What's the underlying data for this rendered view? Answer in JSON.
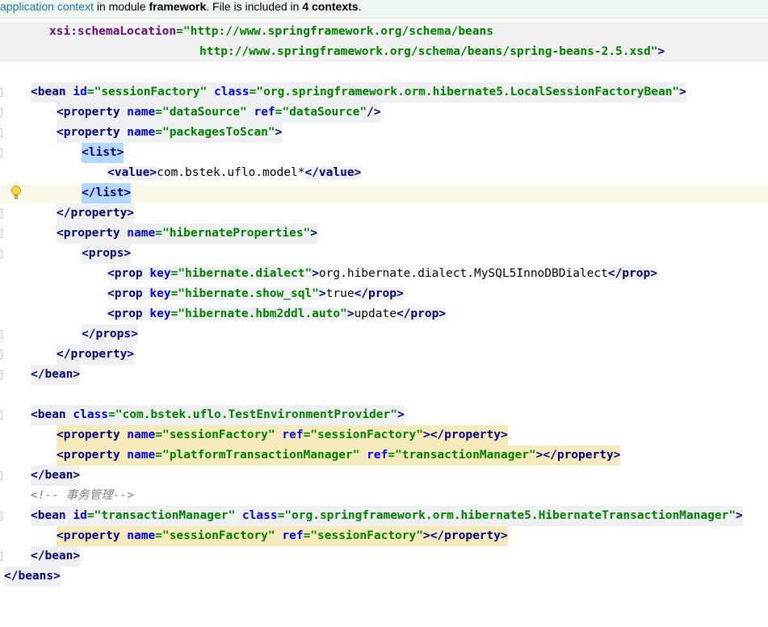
{
  "banner": {
    "link": "application context",
    "t1": " in module ",
    "module": "framework",
    "t2": ". File is included in ",
    "count": "4 contexts",
    "t3": "."
  },
  "code": {
    "l1_a": "xsi:schemaLocation",
    "l1_b": "=\"http://www.springframework.org/schema/beans",
    "l2_a": "http://www.springframework.org/schema/beans/spring-beans-2.5.xsd\"",
    "l2_b": ">",
    "l4_open": "<",
    "l4_tag": "bean",
    "l4_a1": " id",
    "l4_v1": "=\"sessionFactory\"",
    "l4_a2": " class",
    "l4_v2": "=\"org.springframework.orm.hibernate5.LocalSessionFactoryBean\"",
    "l4_close": ">",
    "l5_tag": "<property",
    "l5_a1": " name",
    "l5_v1": "=\"dataSource\"",
    "l5_a2": " ref",
    "l5_v2": "=\"dataSource\"",
    "l5_close": "/>",
    "l6_tag": "<property",
    "l6_a1": " name",
    "l6_v1": "=\"packagesToScan\"",
    "l6_close": ">",
    "l7_lt": "<",
    "l7_tag": "list",
    "l7_gt": ">",
    "l8_tag": "<value>",
    "l8_text": "com.bstek.uflo.model*",
    "l8_end": "</value>",
    "l9_tag": "</list>",
    "l10_tag": "</property>",
    "l11_tag": "<property",
    "l11_a1": " name",
    "l11_v1": "=\"hibernateProperties\"",
    "l11_close": ">",
    "l12_tag": "<props>",
    "l13_tag": "<prop",
    "l13_a1": " key",
    "l13_v1": "=\"hibernate.dialect\"",
    "l13_gt": ">",
    "l13_text": "org.hibernate.dialect.MySQL5InnoDBDialect",
    "l13_end": "</prop>",
    "l14_tag": "<prop",
    "l14_a1": " key",
    "l14_v1": "=\"hibernate.show_sql\"",
    "l14_gt": ">",
    "l14_text": "true",
    "l14_end": "</prop>",
    "l15_tag": "<prop",
    "l15_a1": " key",
    "l15_v1": "=\"hibernate.hbm2ddl.auto\"",
    "l15_gt": ">",
    "l15_text": "update",
    "l15_end": "</prop>",
    "l16_tag": "</props>",
    "l17_tag": "</property>",
    "l18_tag": "</bean>",
    "l20_tag": "<bean",
    "l20_a1": " class",
    "l20_v1": "=\"com.bstek.uflo.TestEnvironmentProvider\"",
    "l20_gt": ">",
    "l21_tag": "<property",
    "l21_a1": " name",
    "l21_v1": "=\"sessionFactory\"",
    "l21_a2": " ref",
    "l21_v2": "=\"sessionFactory\"",
    "l21_gt": ">",
    "l21_end": "</property>",
    "l22_tag": "<property",
    "l22_a1": " name",
    "l22_v1": "=\"platformTransactionManager\"",
    "l22_a2": " ref",
    "l22_v2": "=\"transactionManager\"",
    "l22_gt": ">",
    "l22_end": "</property>",
    "l23_tag": "</bean>",
    "l24_comment": "<!-- 事务管理-->",
    "l25_tag": "<bean",
    "l25_a1": " id",
    "l25_v1": "=\"transactionManager\"",
    "l25_a2": " class",
    "l25_v2": "=\"org.springframework.orm.hibernate5.HibernateTransactionManager\"",
    "l25_gt": ">",
    "l26_tag": "<property",
    "l26_a1": " name",
    "l26_v1": "=\"sessionFactory\"",
    "l26_a2": " ref",
    "l26_v2": "=\"sessionFactory\"",
    "l26_gt": ">",
    "l26_end": "</property>",
    "l27_tag": "</bean>",
    "l28_tag": "</beans>"
  },
  "icons": {
    "gutter": "fold-marker-icon",
    "intention": "lightbulb-icon"
  },
  "colors": {
    "tag": "#000080",
    "attr": "#0000ff",
    "value": "#008000",
    "banner_bg": "#edf7ed",
    "current_line": "#fbfaea",
    "selection": "#b3d7ff"
  }
}
